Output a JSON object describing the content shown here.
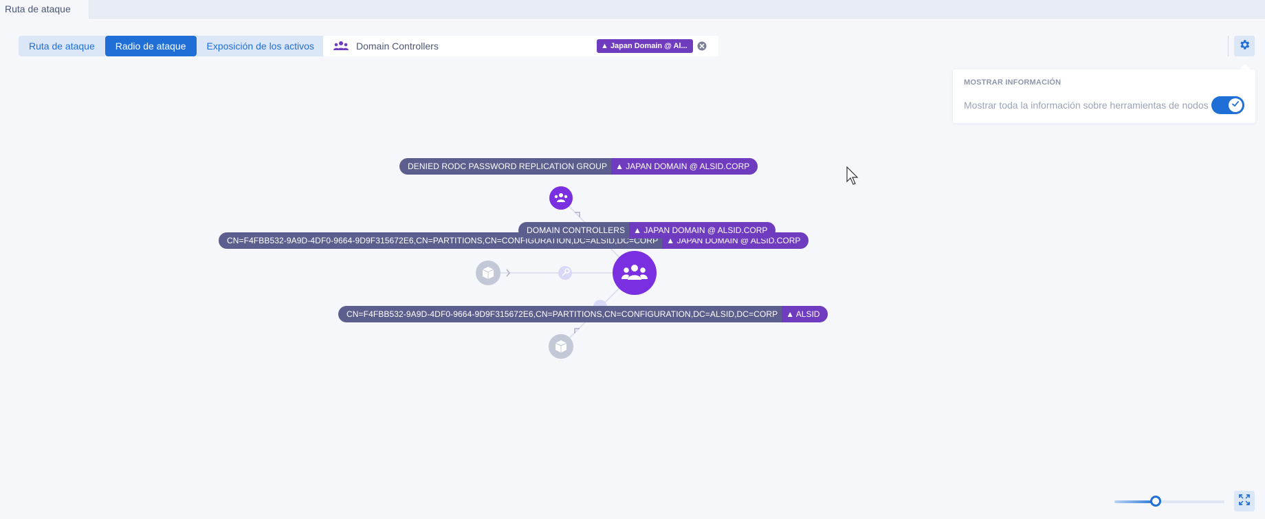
{
  "window": {
    "tab_title": "Ruta de ataque"
  },
  "modes": [
    {
      "label": "Ruta de ataque",
      "active": false
    },
    {
      "label": "Radio de ataque",
      "active": true
    },
    {
      "label": "Exposición de los activos",
      "active": false
    }
  ],
  "search": {
    "entity": "Domain Controllers",
    "domain_chip": "▲ Japan Domain @ Al..."
  },
  "info_panel": {
    "title": "MOSTRAR INFORMACIÓN",
    "toggle_label": "Mostrar toda la información sobre herramientas de nodos",
    "toggle_on": true
  },
  "graph": {
    "labels": [
      {
        "text": "DENIED RODC PASSWORD REPLICATION GROUP",
        "domain": "▲ JAPAN DOMAIN @ ALSID.CORP"
      },
      {
        "text": "CN=F4FBB532-9A9D-4DF0-9664-9D9F315672E6,CN=PARTITIONS,CN=CONFIGURATION,DC=ALSID,DC=CORP",
        "domain": "▲ JAPAN DOMAIN @ ALSID.CORP"
      },
      {
        "text": "DOMAIN CONTROLLERS",
        "domain": "▲ JAPAN DOMAIN @ ALSID.CORP"
      },
      {
        "text": "CN=F4FBB532-9A9D-4DF0-9664-9D9F315672E6,CN=PARTITIONS,CN=CONFIGURATION,DC=ALSID,DC=CORP",
        "domain": "▲ ALSID"
      }
    ]
  },
  "zoom": {
    "level": 0.32
  },
  "colors": {
    "accent": "#1f6fd6",
    "node_purple": "#6f3bbf",
    "label_bg": "#5c5f8e",
    "inactive_node": "#c3c8d6"
  }
}
